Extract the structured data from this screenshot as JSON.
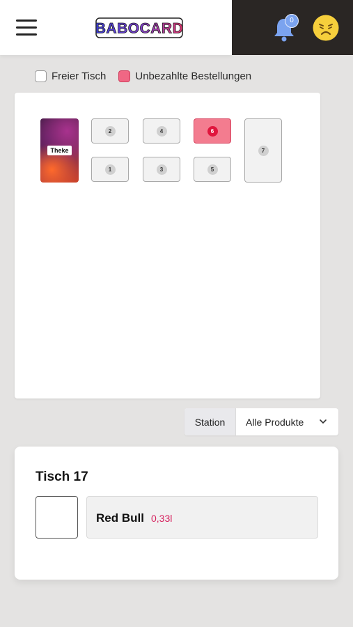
{
  "header": {
    "logo_text": "BABOCARD",
    "notification_count": "0",
    "icons": {
      "menu": "hamburger-icon",
      "bell": "bell-icon",
      "avatar": "frowning-face-icon"
    }
  },
  "legend": {
    "free_label": "Freier Tisch",
    "unpaid_label": "Unbezahlte Bestellungen"
  },
  "floor": {
    "counter_label": "Theke",
    "tables": [
      {
        "number": "2",
        "status": "free"
      },
      {
        "number": "1",
        "status": "free"
      },
      {
        "number": "4",
        "status": "free"
      },
      {
        "number": "3",
        "status": "free"
      },
      {
        "number": "6",
        "status": "unpaid"
      },
      {
        "number": "5",
        "status": "free"
      },
      {
        "number": "7",
        "status": "free"
      }
    ]
  },
  "filter": {
    "label": "Station",
    "selected": "Alle Produkte"
  },
  "order_card": {
    "title": "Tisch 17",
    "items": [
      {
        "name": "Red Bull",
        "size": "0,33l"
      }
    ]
  },
  "colors": {
    "header_dark": "#2a2624",
    "unpaid": "#f37c8f",
    "unpaid_badge": "#e0163d",
    "accent_pink": "#d6225f",
    "bell": "#7ba3ef",
    "avatar": "#f6cf3c"
  }
}
